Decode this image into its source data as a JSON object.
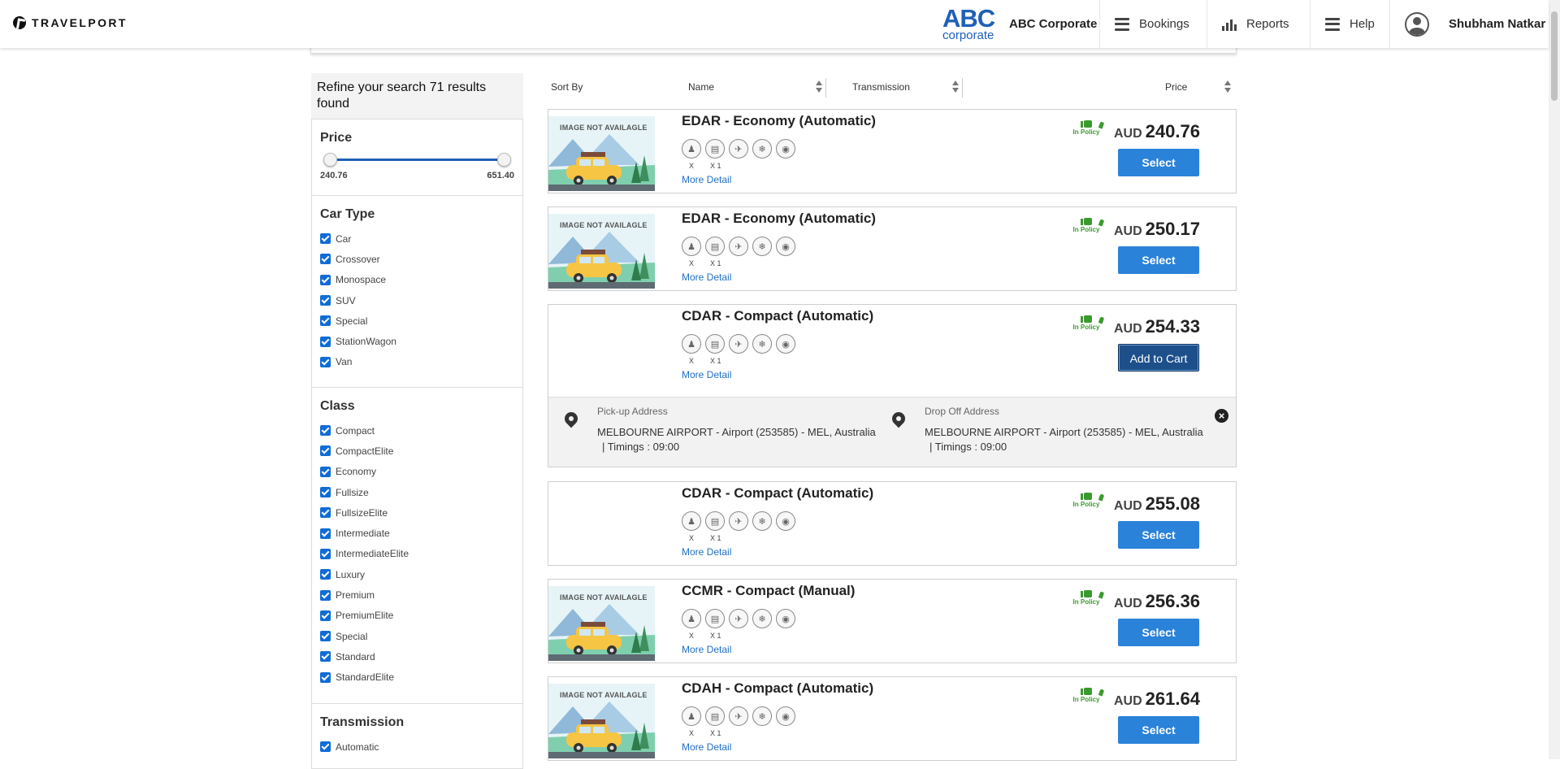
{
  "header": {
    "brand": "TRAVELPORT",
    "corp_logo_main": "ABC",
    "corp_logo_sub": "corporate",
    "corp_name": "ABC Corporate",
    "nav": [
      {
        "label": "Bookings",
        "icon": "menu-icon"
      },
      {
        "label": "Reports",
        "icon": "bar-chart-icon"
      },
      {
        "label": "Help",
        "icon": "menu-icon"
      }
    ],
    "user_name": "Shubham Natkar"
  },
  "sidebar": {
    "refine_title": "Refine your search 71 results found",
    "price": {
      "title": "Price",
      "min": "240.76",
      "max": "651.40"
    },
    "car_type": {
      "title": "Car Type",
      "items": [
        "Car",
        "Crossover",
        "Monospace",
        "SUV",
        "Special",
        "StationWagon",
        "Van"
      ]
    },
    "class": {
      "title": "Class",
      "items": [
        "Compact",
        "CompactElite",
        "Economy",
        "Fullsize",
        "FullsizeElite",
        "Intermediate",
        "IntermediateElite",
        "Luxury",
        "Premium",
        "PremiumElite",
        "Special",
        "Standard",
        "StandardElite"
      ]
    },
    "transmission": {
      "title": "Transmission",
      "items": [
        "Automatic"
      ]
    }
  },
  "sort": {
    "sort_by": "Sort By",
    "name": "Name",
    "transmission": "Transmission",
    "price": "Price"
  },
  "results": [
    {
      "title": "EDAR - Economy (Automatic)",
      "image_text": "IMAGE NOT AVAILAGLE",
      "currency": "AUD",
      "price": "240.76",
      "policy": "In Policy",
      "action": "Select",
      "more": "More Detail",
      "pax": "X",
      "bags": "X 1"
    },
    {
      "title": "EDAR - Economy (Automatic)",
      "image_text": "IMAGE NOT AVAILAGLE",
      "currency": "AUD",
      "price": "250.17",
      "policy": "In Policy",
      "action": "Select",
      "more": "More Detail",
      "pax": "X",
      "bags": "X 1"
    },
    {
      "title": "CDAR - Compact (Automatic)",
      "image_text": "",
      "currency": "AUD",
      "price": "254.33",
      "policy": "In Policy",
      "action": "Add to Cart",
      "more": "More Detail",
      "pax": "X",
      "bags": "X 1",
      "pickup_label": "Pick-up Address",
      "pickup_value": "MELBOURNE AIRPORT - Airport (253585) - MEL, Australia",
      "pickup_timing": "| Timings : 09:00",
      "dropoff_label": "Drop Off Address",
      "dropoff_value": "MELBOURNE AIRPORT - Airport (253585) - MEL, Australia",
      "dropoff_timing": "| Timings : 09:00"
    },
    {
      "title": "CDAR - Compact (Automatic)",
      "image_text": "",
      "currency": "AUD",
      "price": "255.08",
      "policy": "In Policy",
      "action": "Select",
      "more": "More Detail",
      "pax": "X",
      "bags": "X 1"
    },
    {
      "title": "CCMR - Compact (Manual)",
      "image_text": "IMAGE NOT AVAILAGLE",
      "currency": "AUD",
      "price": "256.36",
      "policy": "In Policy",
      "action": "Select",
      "more": "More Detail",
      "pax": "X",
      "bags": "X 1"
    },
    {
      "title": "CDAH - Compact (Automatic)",
      "image_text": "IMAGE NOT AVAILAGLE",
      "currency": "AUD",
      "price": "261.64",
      "policy": "In Policy",
      "action": "Select",
      "more": "More Detail",
      "pax": "X",
      "bags": "X 1"
    }
  ],
  "colors": {
    "primary_button": "#2b82d9",
    "policy_green": "#3b9a2e",
    "link": "#1f6fc5",
    "brand_blue": "#1f5fb7"
  }
}
